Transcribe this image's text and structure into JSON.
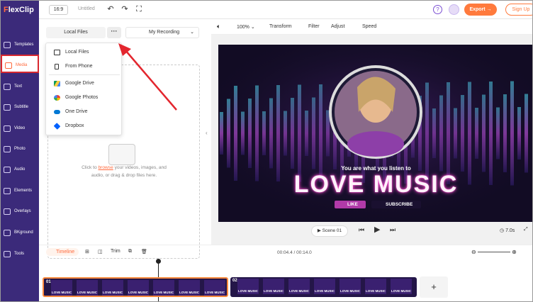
{
  "app": {
    "logo_prefix": "F",
    "logo_rest": "lexClip",
    "brand_color": "#ff6a3d",
    "sidebar_color": "#3b2a7a"
  },
  "topbar": {
    "ratio": "16:9",
    "title": "Untitled",
    "export": "Export →",
    "signup": "Sign Up",
    "help": "?"
  },
  "sidebar": {
    "items": [
      {
        "label": "Templates",
        "icon": "templates-icon"
      },
      {
        "label": "Media",
        "icon": "media-icon",
        "active": true
      },
      {
        "label": "Text",
        "icon": "text-icon"
      },
      {
        "label": "Subtitle",
        "icon": "subtitle-icon"
      },
      {
        "label": "Video",
        "icon": "video-icon"
      },
      {
        "label": "Photo",
        "icon": "photo-icon"
      },
      {
        "label": "Audio",
        "icon": "audio-icon"
      },
      {
        "label": "Elements",
        "icon": "elements-icon"
      },
      {
        "label": "Overlays",
        "icon": "overlays-icon"
      },
      {
        "label": "BKground",
        "icon": "background-icon"
      },
      {
        "label": "Tools",
        "icon": "tools-icon"
      }
    ]
  },
  "panel": {
    "tab_local": "Local Files",
    "more": "···",
    "tab_recording": "My Recording",
    "drop_pre": "Click to ",
    "drop_link": "browse",
    "drop_post": " your videos, images, and audio, or drag & drop files here."
  },
  "menu": {
    "items": [
      {
        "label": "Local Files",
        "icon": "monitor-icon",
        "color": "#333333"
      },
      {
        "label": "From Phone",
        "icon": "phone-icon",
        "color": "#333333"
      },
      {
        "label": "Google Drive",
        "icon": "google-drive-icon",
        "color": "#34a853"
      },
      {
        "label": "Google Photos",
        "icon": "google-photos-icon",
        "color": "#ea4335"
      },
      {
        "label": "One Drive",
        "icon": "onedrive-icon",
        "color": "#0078d4"
      },
      {
        "label": "Dropbox",
        "icon": "dropbox-icon",
        "color": "#0061fe"
      }
    ]
  },
  "toolbar": {
    "zoom": "100%",
    "transform": "Transform",
    "filter": "Filter",
    "adjust": "Adjust",
    "speed": "Speed"
  },
  "video": {
    "tagline": "You are what you listen to",
    "headline": "LOVE MUSIC",
    "like": "LIKE",
    "subscribe": "SUBSCRIBE"
  },
  "player": {
    "scene": "Scene 01",
    "duration": "7.0s"
  },
  "timeline": {
    "label": "Timeline",
    "trim": "Trim",
    "time": "00:04.4 / 00:14.0",
    "clip1": "01",
    "clip2": "02",
    "thumb_text": "LOVE MUSIC"
  }
}
